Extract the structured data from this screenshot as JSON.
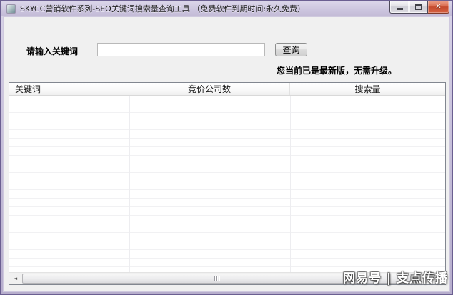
{
  "window": {
    "title": "SKYCC营销软件系列-SEO关键词搜索量查询工具 （免费软件到期时间:永久免费）"
  },
  "form": {
    "keyword_label": "请输入关键词",
    "keyword_value": "",
    "query_button": "查询",
    "update_status": "您当前已是最新版，无需升级。"
  },
  "table": {
    "columns": [
      {
        "label": "关键词",
        "align": "left"
      },
      {
        "label": "竞价公司数",
        "align": "center"
      },
      {
        "label": "搜索量",
        "align": "center"
      }
    ],
    "rows": []
  },
  "scrollbar": {
    "left_arrow": "◄",
    "right_arrow": "►"
  },
  "watermark": "网易号 | 支点传播",
  "colors": {
    "titlebar": "#cdc6df",
    "window_border": "#6b5f91",
    "client_bg": "#f0f0f0",
    "close_button": "#c44a2e",
    "grid_line": "#f1f1f3"
  }
}
